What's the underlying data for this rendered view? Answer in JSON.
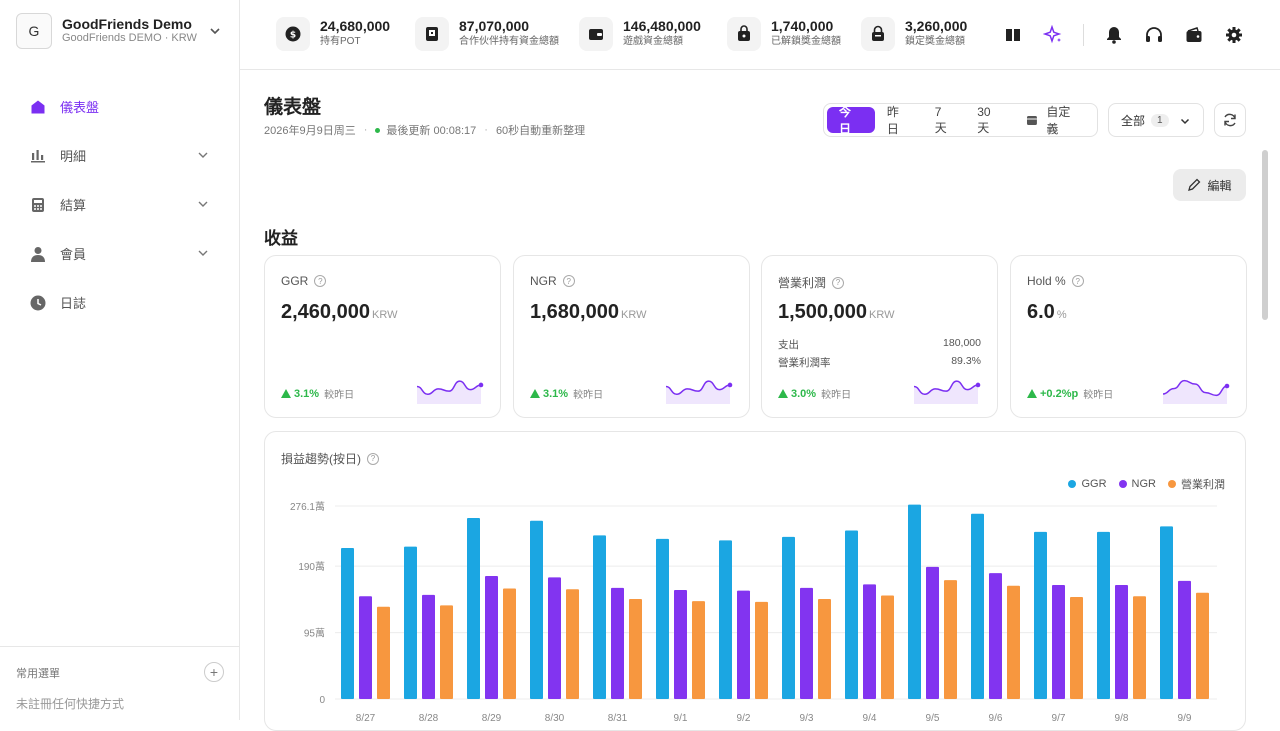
{
  "org": {
    "avatar": "G",
    "name": "GoodFriends Demo",
    "sub": "GoodFriends DEMO · KRW"
  },
  "sidebar": {
    "items": [
      {
        "label": "儀表盤",
        "icon": "home-icon"
      },
      {
        "label": "明細",
        "icon": "bar-chart-icon"
      },
      {
        "label": "結算",
        "icon": "calculator-icon"
      },
      {
        "label": "會員",
        "icon": "user-icon"
      },
      {
        "label": "日誌",
        "icon": "clock-icon"
      }
    ],
    "favorites_title": "常用選單",
    "favorites_empty": "未註冊任何快捷方式",
    "favorites_add": "+"
  },
  "topbar": {
    "stats": [
      {
        "value": "24,680,000",
        "label": "持有POT",
        "icon": "pot-coin-icon"
      },
      {
        "value": "87,070,000",
        "label": "合作伙伴持有資金總額",
        "icon": "partner-wallet-icon"
      },
      {
        "value": "146,480,000",
        "label": "遊戲資金總額",
        "icon": "game-wallet-icon"
      },
      {
        "value": "1,740,000",
        "label": "已解鎖獎金總額",
        "icon": "unlocked-bag-icon"
      },
      {
        "value": "3,260,000",
        "label": "鎖定獎金總額",
        "icon": "locked-bag-icon"
      }
    ],
    "icons": [
      "book-icon",
      "sparkle-icon",
      "bell-icon",
      "headset-icon",
      "wallet-icon",
      "gear-icon"
    ]
  },
  "page": {
    "title": "儀表盤",
    "date": "2026年9月9日周三",
    "updated": "最後更新 00:08:17",
    "auto_refresh": "60秒自動重新整理",
    "ranges": [
      "今日",
      "昨日",
      "7天",
      "30天",
      "自定義"
    ],
    "active_range": "今日",
    "filter_label": "全部",
    "filter_count": "1",
    "edit_label": "編輯",
    "section_title": "收益"
  },
  "colors": {
    "accent": "#7b2ff2",
    "positive": "#2db84a",
    "ggr": "#1ba6e2",
    "ngr": "#8234f0",
    "profit": "#f7973f"
  },
  "cards": [
    {
      "title": "GGR",
      "value": "2,460,000",
      "unit": "KRW",
      "delta": "3.1%",
      "compare": "較昨日",
      "spark": [
        48,
        38,
        45,
        42,
        55,
        44,
        50
      ],
      "sub": []
    },
    {
      "title": "NGR",
      "value": "1,680,000",
      "unit": "KRW",
      "delta": "3.1%",
      "compare": "較昨日",
      "spark": [
        48,
        38,
        45,
        42,
        55,
        44,
        50
      ],
      "sub": []
    },
    {
      "title": "營業利潤",
      "value": "1,500,000",
      "unit": "KRW",
      "delta": "3.0%",
      "compare": "較昨日",
      "spark": [
        48,
        38,
        45,
        42,
        55,
        44,
        50
      ],
      "sub": [
        {
          "label": "支出",
          "value": "180,000"
        },
        {
          "label": "營業利潤率",
          "value": "89.3%"
        }
      ]
    },
    {
      "title": "Hold %",
      "value": "6.0",
      "unit": "%",
      "delta": "+0.2%p",
      "compare": "較昨日",
      "spark": [
        40,
        48,
        60,
        55,
        42,
        38,
        52
      ],
      "sub": []
    }
  ],
  "chart_data": {
    "type": "bar",
    "title": "損益趨勢(按日)",
    "categories": [
      "8/27",
      "8/28",
      "8/29",
      "8/30",
      "8/31",
      "9/1",
      "9/2",
      "9/3",
      "9/4",
      "9/5",
      "9/6",
      "9/7",
      "9/8",
      "9/9"
    ],
    "series": [
      {
        "name": "GGR",
        "color": "#1ba6e2",
        "values": [
          2160000,
          2180000,
          2590000,
          2550000,
          2340000,
          2290000,
          2270000,
          2320000,
          2410000,
          2780000,
          2650000,
          2390000,
          2390000,
          2470000
        ]
      },
      {
        "name": "NGR",
        "color": "#8234f0",
        "values": [
          1470000,
          1490000,
          1760000,
          1740000,
          1590000,
          1560000,
          1550000,
          1590000,
          1640000,
          1890000,
          1800000,
          1630000,
          1630000,
          1690000
        ]
      },
      {
        "name": "營業利潤",
        "color": "#f7973f",
        "values": [
          1320000,
          1340000,
          1580000,
          1570000,
          1430000,
          1400000,
          1390000,
          1430000,
          1480000,
          1700000,
          1620000,
          1460000,
          1470000,
          1520000
        ]
      }
    ],
    "yticks": [
      {
        "value": 0,
        "label": "0"
      },
      {
        "value": 950000,
        "label": "95萬"
      },
      {
        "value": 1900000,
        "label": "190萬"
      },
      {
        "value": 2761000,
        "label": "276.1萬"
      }
    ],
    "ylim": [
      0,
      2761000
    ],
    "legend": "top-right",
    "grid": true
  }
}
